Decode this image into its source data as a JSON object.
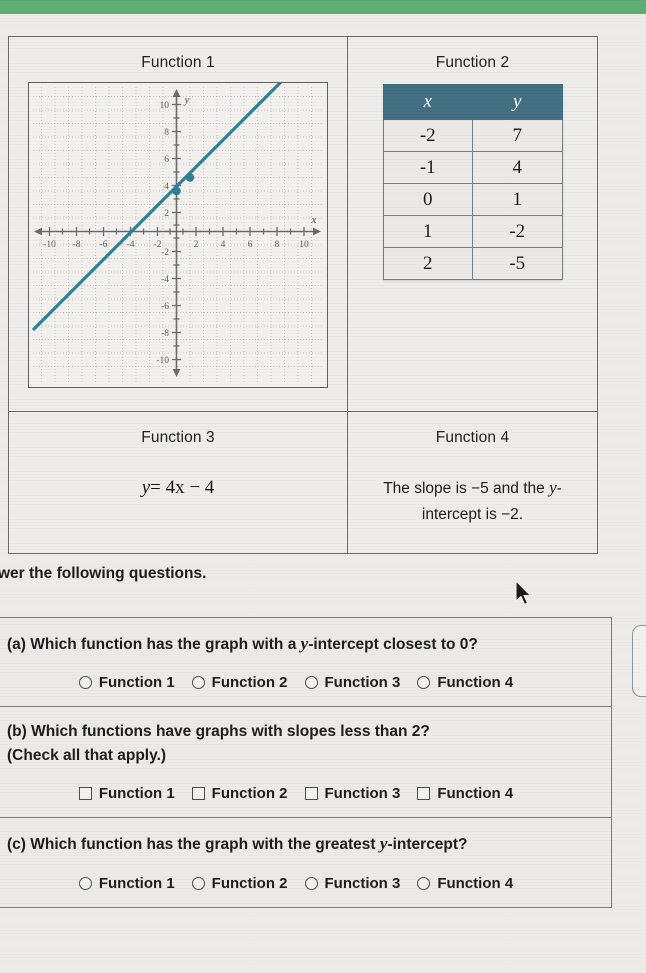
{
  "topbar": {
    "color": "#5ead74"
  },
  "functions": {
    "f1": {
      "title": "Function 1",
      "graph": {
        "xlabel": "x",
        "ylabel": "y",
        "x_ticks": [
          "-10",
          "-8",
          "-6",
          "-4",
          "-2",
          "2",
          "4",
          "6",
          "8",
          "10"
        ],
        "y_ticks": [
          "10",
          "8",
          "6",
          "4",
          "2",
          "-2",
          "-4",
          "-6",
          "-8",
          "-10"
        ],
        "line_color": "#2b7e96",
        "point_color": "#2b7e96"
      }
    },
    "f2": {
      "title": "Function 2",
      "table": {
        "headers": [
          "x",
          "y"
        ],
        "rows": [
          [
            "-2",
            "7"
          ],
          [
            "-1",
            "4"
          ],
          [
            "0",
            "1"
          ],
          [
            "1",
            "-2"
          ],
          [
            "2",
            "-5"
          ]
        ],
        "header_bg": "#3f6d80"
      }
    },
    "f3": {
      "title": "Function 3",
      "equation_y": "y",
      "equation_rest": "= 4x − 4"
    },
    "f4": {
      "title": "Function 4",
      "line1": "The slope is −5 and the",
      "line2_y": "y",
      "line2_rest": "-intercept is −2."
    }
  },
  "instruction": "wer the following questions.",
  "questions": [
    {
      "label_a": "(a) Which function has the graph with a ",
      "label_b": "y",
      "label_c": "-intercept closest to 0?",
      "type": "radio",
      "options": [
        "Function 1",
        "Function 2",
        "Function 3",
        "Function 4"
      ]
    },
    {
      "label_a": "(b) Which functions have graphs with slopes less than 2?",
      "label_b": "",
      "label_c": "",
      "sublabel": "(Check all that apply.)",
      "type": "checkbox",
      "options": [
        "Function 1",
        "Function 2",
        "Function 3",
        "Function 4"
      ]
    },
    {
      "label_a": "(c) Which function has the graph with the greatest ",
      "label_b": "y",
      "label_c": "-intercept?",
      "type": "radio",
      "options": [
        "Function 1",
        "Function 2",
        "Function 3",
        "Function 4"
      ]
    }
  ],
  "chart_data": {
    "type": "line",
    "title": "Function 1",
    "xlabel": "x",
    "ylabel": "y",
    "xlim": [
      -11,
      11
    ],
    "ylim": [
      -11,
      11
    ],
    "grid": true,
    "series": [
      {
        "name": "Function 1 line",
        "equation": "y = x + 3",
        "slope": 1,
        "y_intercept": 3,
        "x_intercept": -3,
        "points_marked": [
          [
            0,
            3
          ],
          [
            1,
            4
          ]
        ],
        "x": [
          -11,
          7
        ],
        "y": [
          -8,
          10
        ]
      }
    ],
    "x_ticks": [
      -10,
      -8,
      -6,
      -4,
      -2,
      2,
      4,
      6,
      8,
      10
    ],
    "y_ticks": [
      10,
      8,
      6,
      4,
      2,
      -2,
      -4,
      -6,
      -8,
      -10
    ]
  }
}
